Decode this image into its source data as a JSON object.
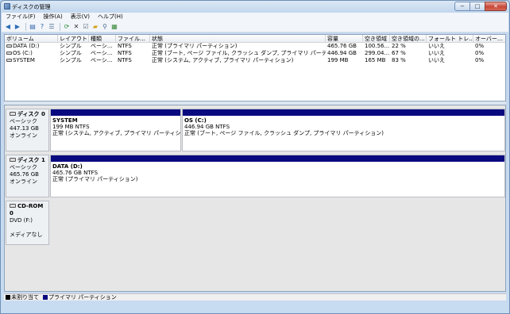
{
  "window": {
    "title": "ディスクの管理",
    "min": "−",
    "max": "□",
    "close": "✕"
  },
  "menu": [
    "ファイル(F)",
    "操作(A)",
    "表示(V)",
    "ヘルプ(H)"
  ],
  "toolbar": [
    {
      "icon": "back-arrow-icon",
      "glyph": "◀",
      "color": "#2d6db5"
    },
    {
      "icon": "forward-arrow-icon",
      "glyph": "▶",
      "color": "#2d6db5"
    },
    {
      "sep": true
    },
    {
      "icon": "properties-icon",
      "glyph": "▤",
      "color": "#3a6ab0"
    },
    {
      "icon": "help-icon",
      "glyph": "?",
      "color": "#2a5ea8"
    },
    {
      "icon": "list-view-icon",
      "glyph": "☰",
      "color": "#4a6a90"
    },
    {
      "sep": true
    },
    {
      "icon": "refresh-icon",
      "glyph": "⟳",
      "color": "#2a8a3a"
    },
    {
      "icon": "delete-icon",
      "glyph": "✕",
      "color": "#333"
    },
    {
      "icon": "checklist-icon",
      "glyph": "☑",
      "color": "#5a6a7a"
    },
    {
      "icon": "open-folder-icon",
      "glyph": "▰",
      "color": "#d4a017"
    },
    {
      "icon": "search-icon",
      "glyph": "⚲",
      "color": "#4a6a90"
    },
    {
      "icon": "disk-properties-icon",
      "glyph": "▦",
      "color": "#3a8a3a"
    }
  ],
  "columns": [
    "ボリューム",
    "レイアウト",
    "種類",
    "ファイル...",
    "状態",
    "容量",
    "空き領域",
    "空き領域の...",
    "フォールト トレ...",
    "オーバー..."
  ],
  "volumes": [
    [
      "DATA (D:)",
      "シンプル",
      "ベーシ...",
      "NTFS",
      "正常 (プライマリ パーティション)",
      "465.76 GB",
      "100.56...",
      "22 %",
      "いいえ",
      "0%"
    ],
    [
      "OS (C:)",
      "シンプル",
      "ベーシ...",
      "NTFS",
      "正常 (ブート, ページ ファイル, クラッシュ ダンプ, プライマリ パーティション)",
      "446.94 GB",
      "299.04...",
      "67 %",
      "いいえ",
      "0%"
    ],
    [
      "SYSTEM",
      "シンプル",
      "ベーシ...",
      "NTFS",
      "正常 (システム, アクティブ, プライマリ パーティション)",
      "199 MB",
      "165 MB",
      "83 %",
      "いいえ",
      "0%"
    ]
  ],
  "disks": [
    {
      "name": "ディスク 0",
      "type": "ベーシック",
      "size": "447.13 GB",
      "status": "オンライン"
    },
    {
      "name": "ディスク 1",
      "type": "ベーシック",
      "size": "465.76 GB",
      "status": "オンライン"
    },
    {
      "name": "CD-ROM 0",
      "type": "DVD (F:)",
      "size": "",
      "status": "メディアなし"
    }
  ],
  "partitions": [
    {
      "name": "SYSTEM",
      "size": "199 MB NTFS",
      "status": "正常 (システム, アクティブ, プライマリ パーティション)"
    },
    {
      "name": "OS  (C:)",
      "size": "446.94 GB NTFS",
      "status": "正常 (ブート, ページ ファイル, クラッシュ ダンプ, プライマリ パーティション)"
    },
    {
      "name": "DATA  (D:)",
      "size": "465.76 GB NTFS",
      "status": "正常 (プライマリ パーティション)"
    }
  ],
  "legend": [
    {
      "label": "未割り当て",
      "color": "#000000"
    },
    {
      "label": "プライマリ パーティション",
      "color": "#0a0a80"
    }
  ]
}
